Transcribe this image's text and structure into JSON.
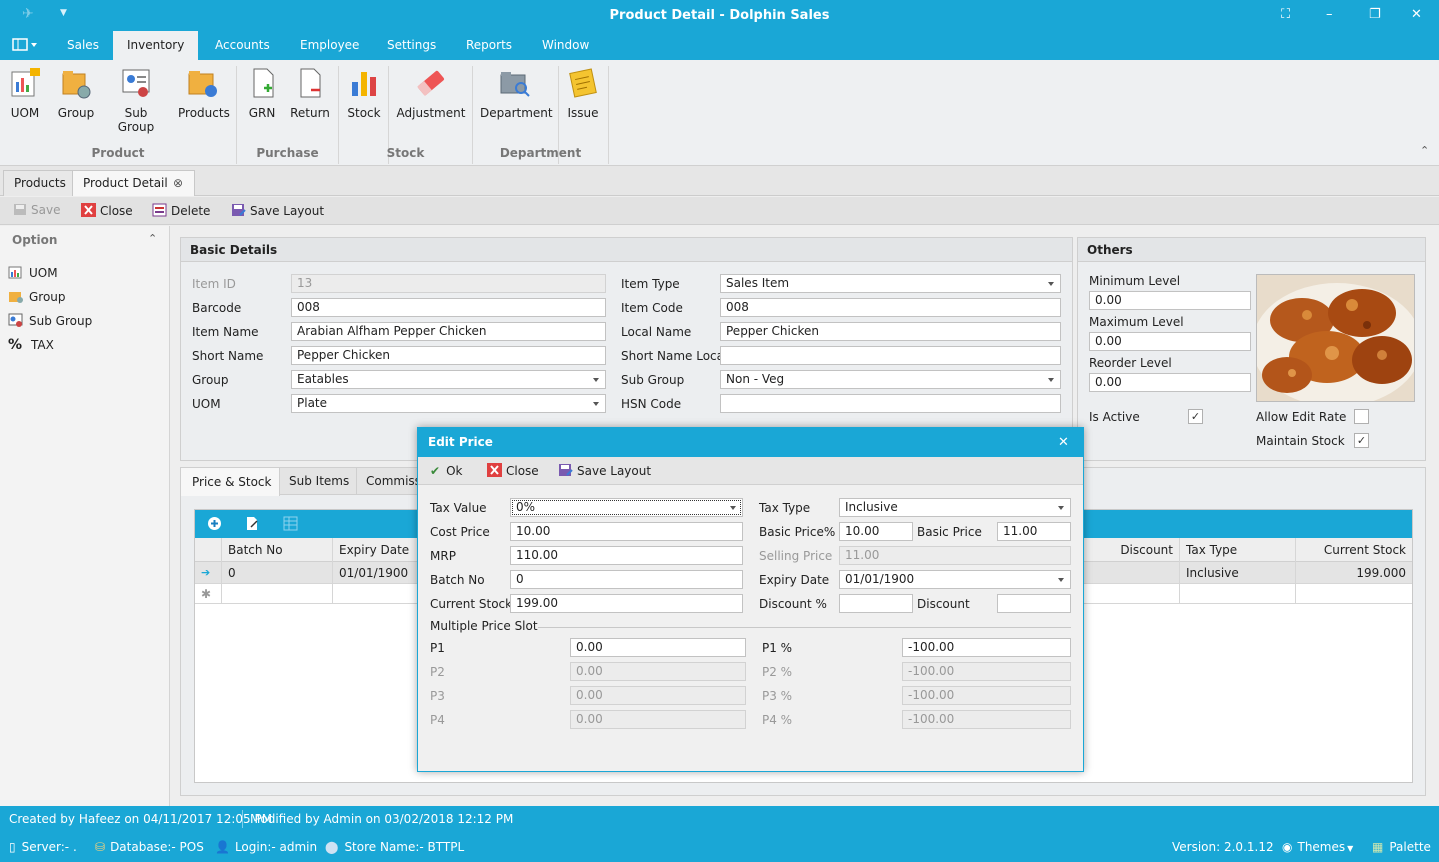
{
  "window": {
    "title": "Product Detail - Dolphin Sales"
  },
  "menu": [
    "Sales",
    "Inventory",
    "Accounts",
    "Employee",
    "Settings",
    "Reports",
    "Window"
  ],
  "ribbon": {
    "buttons": [
      "UOM",
      "Group",
      "Sub Group",
      "Products",
      "GRN",
      "Return",
      "Stock",
      "Adjustment",
      "Department",
      "Issue"
    ],
    "groups": [
      "Product",
      "Purchase",
      "Stock",
      "Department"
    ]
  },
  "doc_tabs": [
    "Products",
    "Product Detail"
  ],
  "toolbar": {
    "save": "Save",
    "close": "Close",
    "delete": "Delete",
    "save_layout": "Save Layout"
  },
  "side": {
    "title": "Option",
    "items": [
      "UOM",
      "Group",
      "Sub Group",
      "TAX"
    ]
  },
  "basic": {
    "title": "Basic Details",
    "item_id_label": "Item ID",
    "item_id": "13",
    "barcode_label": "Barcode",
    "barcode": "008",
    "item_name_label": "Item Name",
    "item_name": "Arabian Alfham Pepper Chicken",
    "short_name_label": "Short Name",
    "short_name": "Pepper Chicken",
    "group_label": "Group",
    "group": "Eatables",
    "uom_label": "UOM",
    "uom": "Plate",
    "item_type_label": "Item Type",
    "item_type": "Sales Item",
    "item_code_label": "Item Code",
    "item_code": "008",
    "local_name_label": "Local Name",
    "local_name": "Pepper Chicken",
    "short_name_local_label": "Short Name Local",
    "short_name_local": "",
    "sub_group_label": "Sub Group",
    "sub_group": "Non - Veg",
    "hsn_label": "HSN Code",
    "hsn": ""
  },
  "others": {
    "title": "Others",
    "min_label": "Minimum Level",
    "min": "0.00",
    "max_label": "Maximum Level",
    "max": "0.00",
    "reorder_label": "Reorder Level",
    "reorder": "0.00",
    "is_active_label": "Is Active",
    "is_active": true,
    "allow_edit_rate_label": "Allow Edit Rate",
    "allow_edit_rate": false,
    "maintain_stock_label": "Maintain Stock",
    "maintain_stock": true
  },
  "lower_tabs": [
    "Price & Stock",
    "Sub Items",
    "Commissi"
  ],
  "grid": {
    "columns": [
      "Batch No",
      "Expiry Date",
      "Discount",
      "Tax Type",
      "Current Stock"
    ],
    "row": {
      "batch": "0",
      "expiry": "01/01/1900",
      "tax_type": "Inclusive",
      "stock": "199.000"
    }
  },
  "dialog": {
    "title": "Edit Price",
    "ok": "Ok",
    "close": "Close",
    "save_layout": "Save Layout",
    "tax_value_label": "Tax Value",
    "tax_value": "0%",
    "cost_price_label": "Cost Price",
    "cost_price": "10.00",
    "mrp_label": "MRP",
    "mrp": "110.00",
    "batch_no_label": "Batch No",
    "batch_no": "0",
    "current_stock_label": "Current Stock",
    "current_stock": "199.00",
    "tax_type_label": "Tax Type",
    "tax_type": "Inclusive",
    "basic_price_pct_label": "Basic Price%",
    "basic_price_pct": "10.00",
    "basic_price_label": "Basic Price",
    "basic_price": "11.00",
    "selling_price_label": "Selling Price",
    "selling_price": "11.00",
    "expiry_label": "Expiry Date",
    "expiry": "01/01/1900",
    "discount_pct_label": "Discount %",
    "discount_pct": "",
    "discount_label": "Discount",
    "discount": "",
    "multi_label": "Multiple Price Slot",
    "slots": [
      {
        "p": "P1",
        "pv": "0.00",
        "pp": "P1 %",
        "ppv": "-100.00"
      },
      {
        "p": "P2",
        "pv": "0.00",
        "pp": "P2 %",
        "ppv": "-100.00"
      },
      {
        "p": "P3",
        "pv": "0.00",
        "pp": "P3 %",
        "ppv": "-100.00"
      },
      {
        "p": "P4",
        "pv": "0.00",
        "pp": "P4 %",
        "ppv": "-100.00"
      }
    ]
  },
  "footer": {
    "created": "Created by Hafeez on 04/11/2017 12:05 PM",
    "modified": "Modified by Admin on 03/02/2018 12:12 PM",
    "server": "Server:- .",
    "database": "Database:- POS",
    "login": "Login:- admin",
    "store": "Store Name:- BTTPL",
    "version": "Version: 2.0.1.12",
    "themes": "Themes",
    "palette": "Palette"
  }
}
